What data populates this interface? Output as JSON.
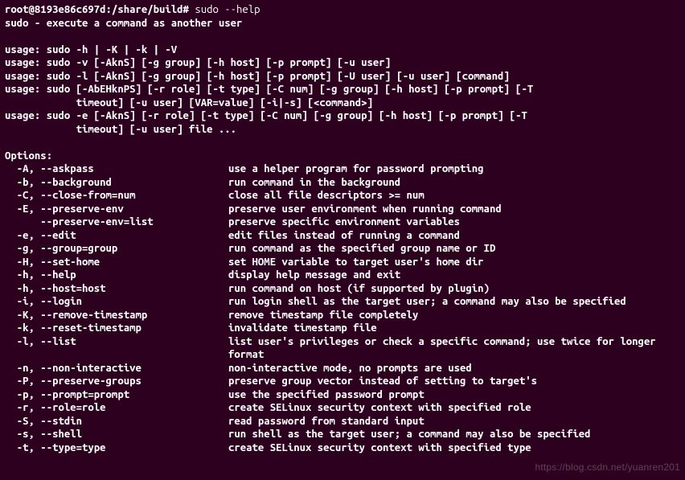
{
  "prompt": {
    "user_host": "root@8193e86c697d",
    "path": ":/share/build#",
    "command": "sudo --help"
  },
  "header": "sudo - execute a command as another user",
  "usage": [
    "usage: sudo -h | -K | -k | -V",
    "usage: sudo -v [-AknS] [-g group] [-h host] [-p prompt] [-u user]",
    "usage: sudo -l [-AknS] [-g group] [-h host] [-p prompt] [-U user] [-u user] [command]",
    "usage: sudo [-AbEHknPS] [-r role] [-t type] [-C num] [-g group] [-h host] [-p prompt] [-T",
    "            timeout] [-u user] [VAR=value] [-i|-s] [<command>]",
    "usage: sudo -e [-AknS] [-r role] [-t type] [-C num] [-g group] [-h host] [-p prompt] [-T",
    "            timeout] [-u user] file ..."
  ],
  "options_header": "Options:",
  "options": [
    {
      "flag": "  -A, --askpass",
      "desc": "use a helper program for password prompting"
    },
    {
      "flag": "  -b, --background",
      "desc": "run command in the background"
    },
    {
      "flag": "  -C, --close-from=num",
      "desc": "close all file descriptors >= num"
    },
    {
      "flag": "  -E, --preserve-env",
      "desc": "preserve user environment when running command"
    },
    {
      "flag": "      --preserve-env=list",
      "desc": "preserve specific environment variables"
    },
    {
      "flag": "  -e, --edit",
      "desc": "edit files instead of running a command"
    },
    {
      "flag": "  -g, --group=group",
      "desc": "run command as the specified group name or ID"
    },
    {
      "flag": "  -H, --set-home",
      "desc": "set HOME variable to target user's home dir"
    },
    {
      "flag": "  -h, --help",
      "desc": "display help message and exit"
    },
    {
      "flag": "  -h, --host=host",
      "desc": "run command on host (if supported by plugin)"
    },
    {
      "flag": "  -i, --login",
      "desc": "run login shell as the target user; a command may also be specified"
    },
    {
      "flag": "  -K, --remove-timestamp",
      "desc": "remove timestamp file completely"
    },
    {
      "flag": "  -k, --reset-timestamp",
      "desc": "invalidate timestamp file"
    },
    {
      "flag": "  -l, --list",
      "desc": "list user's privileges or check a specific command; use twice for longer format"
    },
    {
      "flag": "  -n, --non-interactive",
      "desc": "non-interactive mode, no prompts are used"
    },
    {
      "flag": "  -P, --preserve-groups",
      "desc": "preserve group vector instead of setting to target's"
    },
    {
      "flag": "  -p, --prompt=prompt",
      "desc": "use the specified password prompt"
    },
    {
      "flag": "  -r, --role=role",
      "desc": "create SELinux security context with specified role"
    },
    {
      "flag": "  -S, --stdin",
      "desc": "read password from standard input"
    },
    {
      "flag": "  -s, --shell",
      "desc": "run shell as the target user; a command may also be specified"
    },
    {
      "flag": "  -t, --type=type",
      "desc": "create SELinux security context with specified type"
    }
  ],
  "watermark": "https://blog.csdn.net/yuanren201"
}
